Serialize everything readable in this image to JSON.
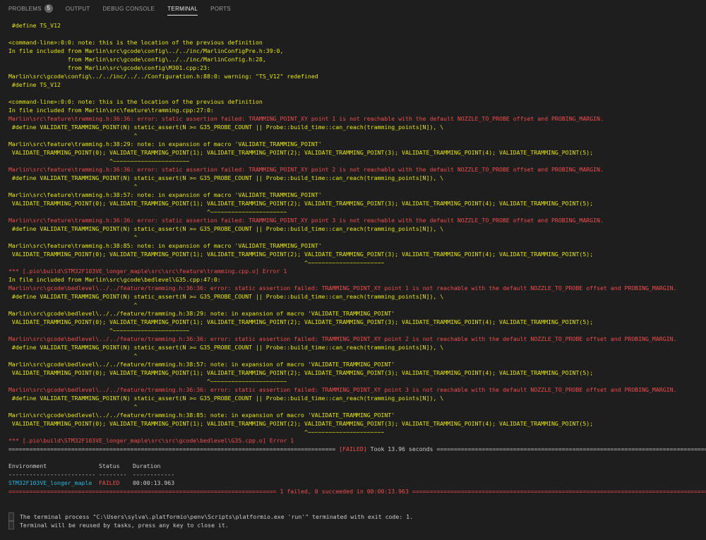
{
  "tabs": {
    "problems": "PROBLEMS",
    "problems_count": "5",
    "output": "OUTPUT",
    "debug": "DEBUG CONSOLE",
    "terminal": "TERMINAL",
    "ports": "PORTS"
  },
  "colors": {
    "warning": "#e5e510",
    "error": "#f14c4c",
    "env": "#29b8db",
    "background": "#1e1e1e"
  },
  "lines": [
    {
      "t": " #define TS_V12",
      "c": "y"
    },
    {
      "t": "",
      "c": "y"
    },
    {
      "t": "<command-line>:0:0: note: this is the location of the previous definition",
      "c": "y"
    },
    {
      "t": "In file included from Marlin\\src\\gcode\\config\\../../inc/MarlinConfigPre.h:39:0,",
      "c": "y"
    },
    {
      "t": "                 from Marlin\\src\\gcode\\config\\../../inc/MarlinConfig.h:28,",
      "c": "y"
    },
    {
      "t": "                 from Marlin\\src\\gcode\\config\\M301.cpp:23:",
      "c": "y"
    },
    {
      "t": "Marlin\\src\\gcode\\config\\../../inc/../../Configuration.h:88:0: warning: \"TS_V12\" redefined",
      "c": "y"
    },
    {
      "t": " #define TS_V12",
      "c": "y"
    },
    {
      "t": "",
      "c": "y"
    },
    {
      "t": "<command-line>:0:0: note: this is the location of the previous definition",
      "c": "y"
    },
    {
      "t": "In file included from Marlin\\src\\feature\\tramming.cpp:27:0:",
      "c": "y"
    },
    {
      "t": "Marlin\\src\\feature\\tramming.h:36:36: error: static assertion failed: TRAMMING_POINT_XY point 1 is not reachable with the default NOZZLE_TO_PROBE offset and PROBING_MARGIN.",
      "c": "r"
    },
    {
      "t": " #define VALIDATE_TRAMMING_POINT(N) static_assert(N >= G35_PROBE_COUNT || Probe::build_time::can_reach(tramming_points[N]), \\",
      "c": "y"
    },
    {
      "t": "                                    ^",
      "c": "y"
    },
    {
      "t": "Marlin\\src\\feature\\tramming.h:38:29: note: in expansion of macro 'VALIDATE_TRAMMING_POINT'",
      "c": "y"
    },
    {
      "t": " VALIDATE_TRAMMING_POINT(0); VALIDATE_TRAMMING_POINT(1); VALIDATE_TRAMMING_POINT(2); VALIDATE_TRAMMING_POINT(3); VALIDATE_TRAMMING_POINT(4); VALIDATE_TRAMMING_POINT(5);",
      "c": "y"
    },
    {
      "t": "                             ^~~~~~~~~~~~~~~~~~~~~~~",
      "c": "y"
    },
    {
      "t": "Marlin\\src\\feature\\tramming.h:36:36: error: static assertion failed: TRAMMING_POINT_XY point 2 is not reachable with the default NOZZLE_TO_PROBE offset and PROBING_MARGIN.",
      "c": "r"
    },
    {
      "t": " #define VALIDATE_TRAMMING_POINT(N) static_assert(N >= G35_PROBE_COUNT || Probe::build_time::can_reach(tramming_points[N]), \\",
      "c": "y"
    },
    {
      "t": "                                    ^",
      "c": "y"
    },
    {
      "t": "Marlin\\src\\feature\\tramming.h:38:57: note: in expansion of macro 'VALIDATE_TRAMMING_POINT'",
      "c": "y"
    },
    {
      "t": " VALIDATE_TRAMMING_POINT(0); VALIDATE_TRAMMING_POINT(1); VALIDATE_TRAMMING_POINT(2); VALIDATE_TRAMMING_POINT(3); VALIDATE_TRAMMING_POINT(4); VALIDATE_TRAMMING_POINT(5);",
      "c": "y"
    },
    {
      "t": "                                                         ^~~~~~~~~~~~~~~~~~~~~~~",
      "c": "y"
    },
    {
      "t": "Marlin\\src\\feature\\tramming.h:36:36: error: static assertion failed: TRAMMING_POINT_XY point 3 is not reachable with the default NOZZLE_TO_PROBE offset and PROBING_MARGIN.",
      "c": "r"
    },
    {
      "t": " #define VALIDATE_TRAMMING_POINT(N) static_assert(N >= G35_PROBE_COUNT || Probe::build_time::can_reach(tramming_points[N]), \\",
      "c": "y"
    },
    {
      "t": "                                    ^",
      "c": "y"
    },
    {
      "t": "Marlin\\src\\feature\\tramming.h:38:85: note: in expansion of macro 'VALIDATE_TRAMMING_POINT'",
      "c": "y"
    },
    {
      "t": " VALIDATE_TRAMMING_POINT(0); VALIDATE_TRAMMING_POINT(1); VALIDATE_TRAMMING_POINT(2); VALIDATE_TRAMMING_POINT(3); VALIDATE_TRAMMING_POINT(4); VALIDATE_TRAMMING_POINT(5);",
      "c": "y"
    },
    {
      "t": "                                                                                     ^~~~~~~~~~~~~~~~~~~~~~~",
      "c": "y"
    },
    {
      "t": "*** [.pio\\build\\STM32F103VE_longer_maple\\src\\src\\feature\\tramming.cpp.o] Error 1",
      "c": "r"
    },
    {
      "t": "In file included from Marlin\\src\\gcode\\bedlevel\\G35.cpp:47:0:",
      "c": "y"
    },
    {
      "t": "Marlin\\src\\gcode\\bedlevel\\../../feature/tramming.h:36:36: error: static assertion failed: TRAMMING_POINT_XY point 1 is not reachable with the default NOZZLE_TO_PROBE offset and PROBING_MARGIN.",
      "c": "r"
    },
    {
      "t": " #define VALIDATE_TRAMMING_POINT(N) static_assert(N >= G35_PROBE_COUNT || Probe::build_time::can_reach(tramming_points[N]), \\",
      "c": "y"
    },
    {
      "t": "                                    ^",
      "c": "y"
    },
    {
      "t": "Marlin\\src\\gcode\\bedlevel\\../../feature/tramming.h:38:29: note: in expansion of macro 'VALIDATE_TRAMMING_POINT'",
      "c": "y"
    },
    {
      "t": " VALIDATE_TRAMMING_POINT(0); VALIDATE_TRAMMING_POINT(1); VALIDATE_TRAMMING_POINT(2); VALIDATE_TRAMMING_POINT(3); VALIDATE_TRAMMING_POINT(4); VALIDATE_TRAMMING_POINT(5);",
      "c": "y"
    },
    {
      "t": "                             ^~~~~~~~~~~~~~~~~~~~~~~",
      "c": "y"
    },
    {
      "t": "Marlin\\src\\gcode\\bedlevel\\../../feature/tramming.h:36:36: error: static assertion failed: TRAMMING_POINT_XY point 2 is not reachable with the default NOZZLE_TO_PROBE offset and PROBING_MARGIN.",
      "c": "r"
    },
    {
      "t": " #define VALIDATE_TRAMMING_POINT(N) static_assert(N >= G35_PROBE_COUNT || Probe::build_time::can_reach(tramming_points[N]), \\",
      "c": "y"
    },
    {
      "t": "                                    ^",
      "c": "y"
    },
    {
      "t": "Marlin\\src\\gcode\\bedlevel\\../../feature/tramming.h:38:57: note: in expansion of macro 'VALIDATE_TRAMMING_POINT'",
      "c": "y"
    },
    {
      "t": " VALIDATE_TRAMMING_POINT(0); VALIDATE_TRAMMING_POINT(1); VALIDATE_TRAMMING_POINT(2); VALIDATE_TRAMMING_POINT(3); VALIDATE_TRAMMING_POINT(4); VALIDATE_TRAMMING_POINT(5);",
      "c": "y"
    },
    {
      "t": "                                                         ^~~~~~~~~~~~~~~~~~~~~~~",
      "c": "y"
    },
    {
      "t": "Marlin\\src\\gcode\\bedlevel\\../../feature/tramming.h:36:36: error: static assertion failed: TRAMMING_POINT_XY point 3 is not reachable with the default NOZZLE_TO_PROBE offset and PROBING_MARGIN.",
      "c": "r"
    },
    {
      "t": " #define VALIDATE_TRAMMING_POINT(N) static_assert(N >= G35_PROBE_COUNT || Probe::build_time::can_reach(tramming_points[N]), \\",
      "c": "y"
    },
    {
      "t": "                                    ^",
      "c": "y"
    },
    {
      "t": "Marlin\\src\\gcode\\bedlevel\\../../feature/tramming.h:38:85: note: in expansion of macro 'VALIDATE_TRAMMING_POINT'",
      "c": "y"
    },
    {
      "t": " VALIDATE_TRAMMING_POINT(0); VALIDATE_TRAMMING_POINT(1); VALIDATE_TRAMMING_POINT(2); VALIDATE_TRAMMING_POINT(3); VALIDATE_TRAMMING_POINT(4); VALIDATE_TRAMMING_POINT(5);",
      "c": "y"
    },
    {
      "t": "                                                                                     ^~~~~~~~~~~~~~~~~~~~~~~",
      "c": "y"
    },
    {
      "t": "*** [.pio\\build\\STM32F103VE_longer_maple\\src\\src\\gcode\\bedlevel\\G35.cpp.o] Error 1",
      "c": "r"
    }
  ],
  "summary": {
    "sep_left": "==============================================================================================",
    "failed_tag": "[FAILED]",
    "took": " Took 13.96 seconds ",
    "sep_right": "========================================================================================",
    "col_env": "Environment",
    "col_status": "Status",
    "col_duration": "Duration",
    "dash_env": "-------------------------",
    "dash_status": "--------",
    "dash_duration": "------------",
    "env_name": "STM32F103VE_longer_maple",
    "env_status": "FAILED",
    "env_duration": "00:00:13.963",
    "sep2_left": "=============================================================================",
    "result": " 1 failed, 0 succeeded in 00:00:13.963 ",
    "sep2_right": "=============================================================================================="
  },
  "footer": {
    "line1": "The terminal process \"C:\\Users\\sylva\\.platformio\\penv\\Scripts\\platformio.exe 'run'\" terminated with exit code: 1.",
    "line2": "Terminal will be reused by tasks, press any key to close it."
  }
}
